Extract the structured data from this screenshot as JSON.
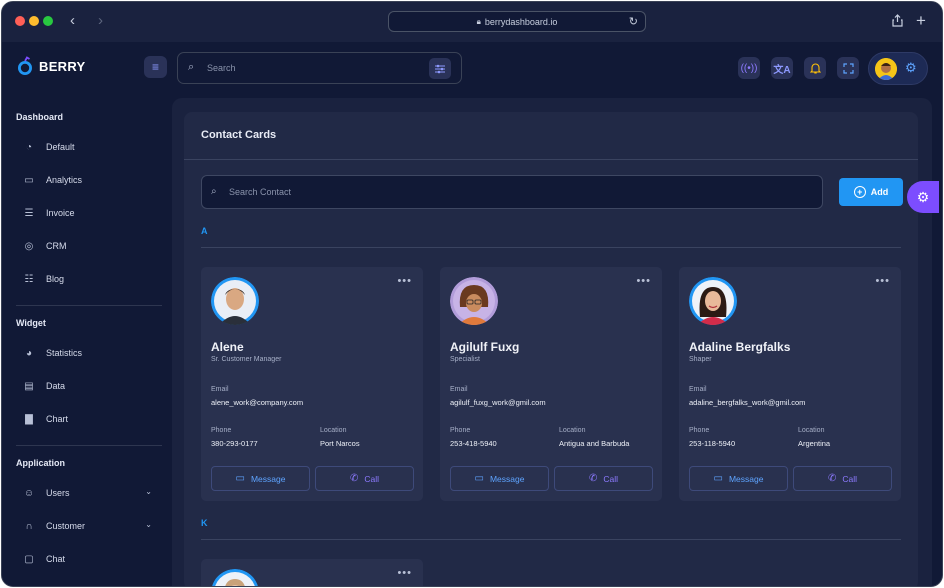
{
  "browser": {
    "url": "berrydashboard.io",
    "traffic_colors": [
      "#ff5f57",
      "#febc2e",
      "#28c840"
    ]
  },
  "header": {
    "brand": "BERRY",
    "search_placeholder": "Search"
  },
  "sidebar": {
    "sections": [
      {
        "title": "Dashboard",
        "items": [
          {
            "label": "Default",
            "icon": "dashboard-gauge-icon"
          },
          {
            "label": "Analytics",
            "icon": "monitor-icon"
          },
          {
            "label": "Invoice",
            "icon": "document-icon"
          },
          {
            "label": "CRM",
            "icon": "target-icon"
          },
          {
            "label": "Blog",
            "icon": "list-icon"
          }
        ]
      },
      {
        "title": "Widget",
        "items": [
          {
            "label": "Statistics",
            "icon": "chart-pie-icon"
          },
          {
            "label": "Data",
            "icon": "clipboard-icon"
          },
          {
            "label": "Chart",
            "icon": "chart-bar-icon"
          }
        ]
      },
      {
        "title": "Application",
        "items": [
          {
            "label": "Users",
            "icon": "user-icon"
          },
          {
            "label": "Customer",
            "icon": "headset-icon"
          },
          {
            "label": "Chat",
            "icon": "chat-icon"
          }
        ]
      }
    ]
  },
  "main": {
    "title": "Contact Cards",
    "search_placeholder": "Search Contact",
    "add_label": "Add",
    "groups": [
      {
        "letter": "A",
        "contacts": [
          {
            "name": "Alene",
            "role": "Sr. Customer Manager",
            "email_label": "Email",
            "email": "alene_work@company.com",
            "phone_label": "Phone",
            "phone": "380-293-0177",
            "location_label": "Location",
            "location": "Port Narcos",
            "message_label": "Message",
            "call_label": "Call"
          },
          {
            "name": "Agilulf Fuxg",
            "role": "Specialist",
            "email_label": "Email",
            "email": "agilulf_fuxg_work@gmil.com",
            "phone_label": "Phone",
            "phone": "253-418-5940",
            "location_label": "Location",
            "location": "Antigua and Barbuda",
            "message_label": "Message",
            "call_label": "Call"
          },
          {
            "name": "Adaline Bergfalks",
            "role": "Shaper",
            "email_label": "Email",
            "email": "adaline_bergfalks_work@gmil.com",
            "phone_label": "Phone",
            "phone": "253-118-5940",
            "location_label": "Location",
            "location": "Argentina",
            "message_label": "Message",
            "call_label": "Call"
          }
        ]
      },
      {
        "letter": "K",
        "contacts": []
      }
    ]
  },
  "colors": {
    "accent_blue": "#2196f3",
    "accent_purple": "#7c4dff",
    "background": "#111936",
    "card": "#29314f"
  }
}
